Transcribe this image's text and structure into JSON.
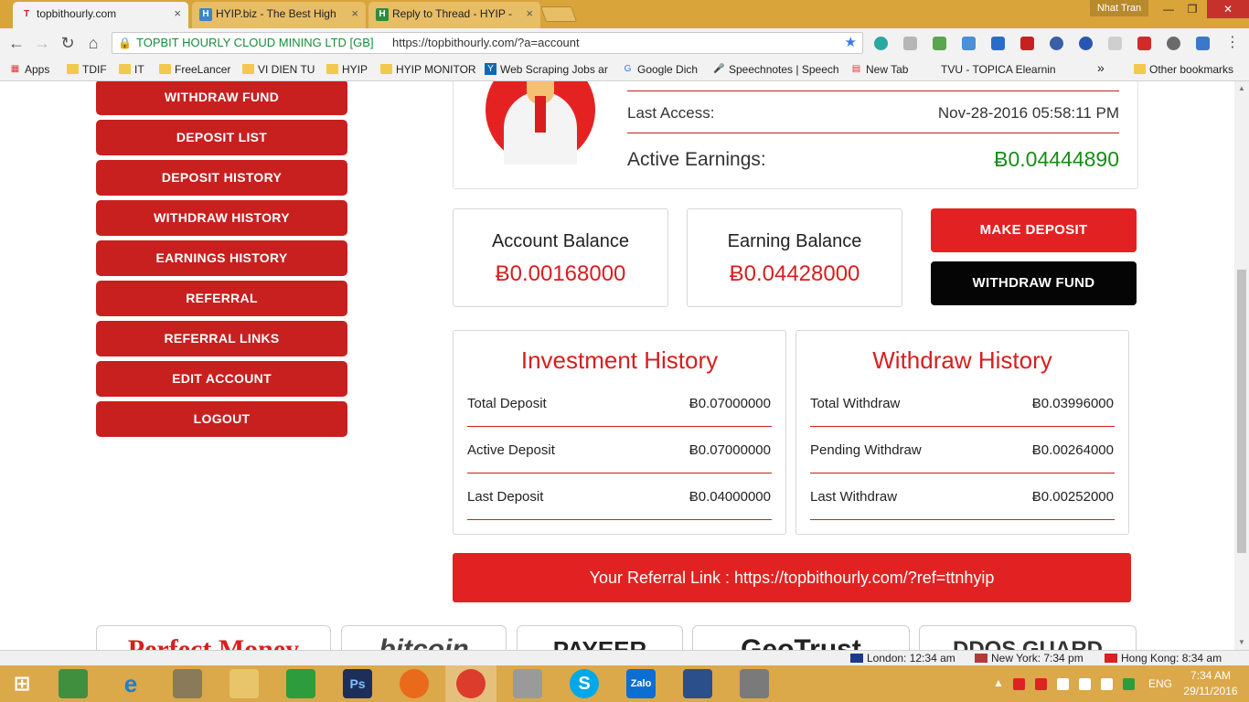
{
  "browser": {
    "tabs": [
      {
        "title": "topbithourly.com",
        "favicon": "T",
        "color": "#d81e1e"
      },
      {
        "title": "HYIP.biz - The Best High",
        "favicon": "H",
        "color": "#3b86c6"
      },
      {
        "title": "Reply to Thread - HYIP -",
        "favicon": "H",
        "color": "#2f8a3e"
      }
    ],
    "close_glyph": "×",
    "user": "Nhat Tran",
    "address": {
      "site_name": "TOPBIT HOURLY CLOUD MINING LTD [GB]",
      "url": "https://topbithourly.com/?a=account"
    },
    "bookmarks": [
      {
        "label": "Apps",
        "type": "apps"
      },
      {
        "label": "TDIF",
        "type": "folder"
      },
      {
        "label": "IT",
        "type": "folder"
      },
      {
        "label": "FreeLancer",
        "type": "folder"
      },
      {
        "label": "VI DIEN TU",
        "type": "folder"
      },
      {
        "label": "HYIP",
        "type": "folder"
      },
      {
        "label": "HYIP MONITOR",
        "type": "folder"
      },
      {
        "label": "Web Scraping Jobs ar",
        "type": "site"
      },
      {
        "label": "Google Dich",
        "type": "site"
      },
      {
        "label": "Speechnotes | Speech",
        "type": "site"
      },
      {
        "label": "New Tab",
        "type": "site"
      },
      {
        "label": "TVU - TOPICA Elearnin",
        "type": "site"
      }
    ],
    "bookmarks_overflow": "»",
    "other_bookmarks": "Other bookmarks"
  },
  "sidebar": {
    "items": [
      "WITHDRAW FUND",
      "DEPOSIT LIST",
      "DEPOSIT HISTORY",
      "WITHDRAW HISTORY",
      "EARNINGS HISTORY",
      "REFERRAL",
      "REFERRAL LINKS",
      "EDIT ACCOUNT",
      "LOGOUT"
    ]
  },
  "profile": {
    "last_access_label": "Last Access:",
    "last_access_value": "Nov-28-2016 05:58:11 PM",
    "active_earnings_label": "Active Earnings:",
    "active_earnings_value": "Ƀ0.04444890"
  },
  "balances": {
    "account_label": "Account Balance",
    "account_value": "Ƀ0.00168000",
    "earning_label": "Earning Balance",
    "earning_value": "Ƀ0.04428000"
  },
  "actions": {
    "make_deposit": "MAKE DEPOSIT",
    "withdraw_fund": "WITHDRAW FUND"
  },
  "investment_history": {
    "title": "Investment History",
    "rows": [
      {
        "label": "Total Deposit",
        "value": "Ƀ0.07000000"
      },
      {
        "label": "Active Deposit",
        "value": "Ƀ0.07000000"
      },
      {
        "label": "Last Deposit",
        "value": "Ƀ0.04000000"
      }
    ]
  },
  "withdraw_history": {
    "title": "Withdraw History",
    "rows": [
      {
        "label": "Total Withdraw",
        "value": "Ƀ0.03996000"
      },
      {
        "label": "Pending Withdraw",
        "value": "Ƀ0.00264000"
      },
      {
        "label": "Last Withdraw",
        "value": "Ƀ0.00252000"
      }
    ]
  },
  "referral": {
    "text": "Your Referral Link : https://topbithourly.com/?ref=ttnhyip"
  },
  "payment_logos": [
    "Perfect Money",
    "bitcoin",
    "PAYEER",
    "GeoTrust",
    "DDOS GUARD"
  ],
  "world_clock": [
    {
      "label": "London: 12:34 am"
    },
    {
      "label": "New York: 7:34 pm"
    },
    {
      "label": "Hong Kong: 8:34 am"
    }
  ],
  "taskbar": {
    "apps": [
      "windows-start",
      "excel-chart",
      "internet-explorer",
      "tools",
      "file-explorer",
      "windows-store",
      "photoshop",
      "firefox",
      "chrome",
      "calculator",
      "skype",
      "zalo",
      "virtualbox",
      "camera"
    ],
    "language": "ENG",
    "time": "7:34 AM",
    "date": "29/11/2016"
  },
  "colors": {
    "brand_red": "#c81f1f",
    "value_red": "#d81e1e",
    "earnings_green": "#1a8c1a",
    "taskbar": "#dba84a"
  }
}
